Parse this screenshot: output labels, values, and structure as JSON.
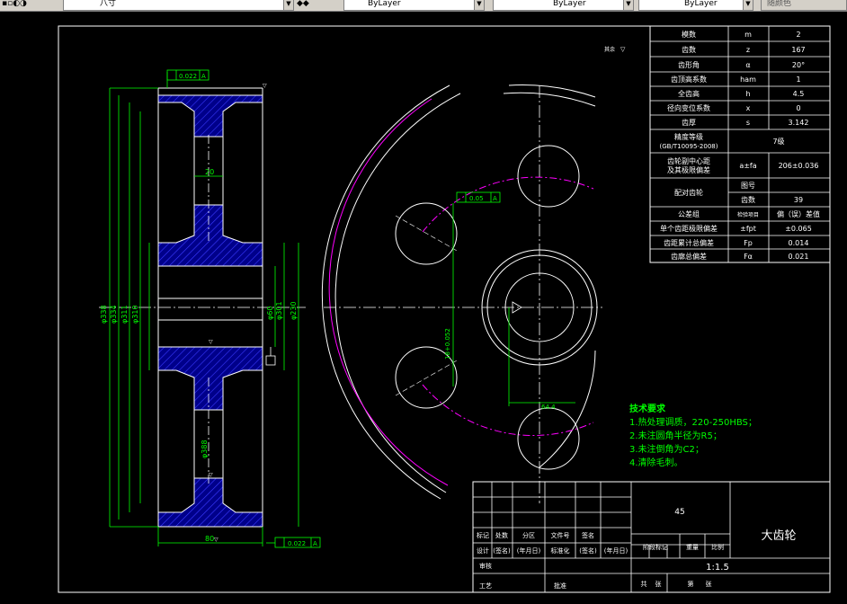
{
  "toolbar": {
    "layer_value": "八寸",
    "color_value": "ByLayer",
    "linetype_value": "ByLayer",
    "lineweight_value": "ByLayer",
    "plotstyle_value": "随颜色"
  },
  "param_table": {
    "rows": [
      {
        "name": "模数",
        "symbol": "m",
        "value": "2"
      },
      {
        "name": "齿数",
        "symbol": "z",
        "value": "167"
      },
      {
        "name": "齿形角",
        "symbol": "α",
        "value": "20°"
      },
      {
        "name": "齿顶高系数",
        "symbol": "ham",
        "value": "1"
      },
      {
        "name": "全齿高",
        "symbol": "h",
        "value": "4.5"
      },
      {
        "name": "径向变位系数",
        "symbol": "x",
        "value": "0"
      },
      {
        "name": "齿厚",
        "symbol": "s",
        "value": "3.142"
      }
    ],
    "precision_label_1": "精度等级",
    "precision_label_2": "(GB/T10095-2008)",
    "precision_value": "7级",
    "center_label_1": "齿轮副中心距",
    "center_label_2": "及其极限偏差",
    "center_symbol": "a±fa",
    "center_value": "206±0.036",
    "pair_label": "配对齿轮",
    "pair_no_label": "图号",
    "pair_teeth_label": "齿数",
    "pair_teeth_value": "39",
    "tol_group_label": "公差组",
    "tol_check_label": "检验项目",
    "tol_check_value": "偏（误）差值",
    "tol_rows": [
      {
        "name": "单个齿距极限偏差",
        "symbol": "±fpt",
        "value": "±0.065"
      },
      {
        "name": "齿距累计总偏差",
        "symbol": "Fp",
        "value": "0.014"
      },
      {
        "name": "齿廓总偏差",
        "symbol": "Fα",
        "value": "0.021"
      }
    ]
  },
  "rest_roughness": "其余",
  "tech_req": {
    "title": "技术要求",
    "items": [
      "1.热处理调质，220-250HBS；",
      "2.未注圆角半径为R5；",
      "3.未注倒角为C2；",
      "4.清除毛刺。"
    ]
  },
  "title_block": {
    "material": "45",
    "part_name": "大齿轮",
    "scale_value": "1:1.5",
    "headers": [
      "标记",
      "处数",
      "分区",
      "文件号",
      "签名"
    ],
    "design_row": [
      "设计",
      "(签名)",
      "(年月日)",
      "标准化",
      "(签名)",
      "(年月日)"
    ],
    "stage_label": "阶段标记",
    "weight_label": "重量",
    "scale_label": "比例",
    "review_label": "审核",
    "process_label": "工艺",
    "approve_label": "批准",
    "sheets_total_label": "共",
    "sheets_label": "张",
    "sheet_no_label": "第",
    "sheet_no_label2": "张"
  },
  "dims": {
    "gtol_top": "0.022",
    "gtol_top_ref": "A",
    "gtol_bottom": "0.022",
    "gtol_bottom_ref": "A",
    "gtol_hub": "0.05",
    "gtol_hub_ref": "A",
    "d1": "φ338",
    "d2": "φ334",
    "d3": "φ311",
    "d4": "φ310",
    "d5": "φ60",
    "d6": "φ301",
    "d7": "φ230",
    "d8": "φ388",
    "web": "20",
    "width": "80",
    "bore": "φ60",
    "hole_pos": "18+0.052",
    "key": "64.4",
    "chamfer": "C2"
  }
}
